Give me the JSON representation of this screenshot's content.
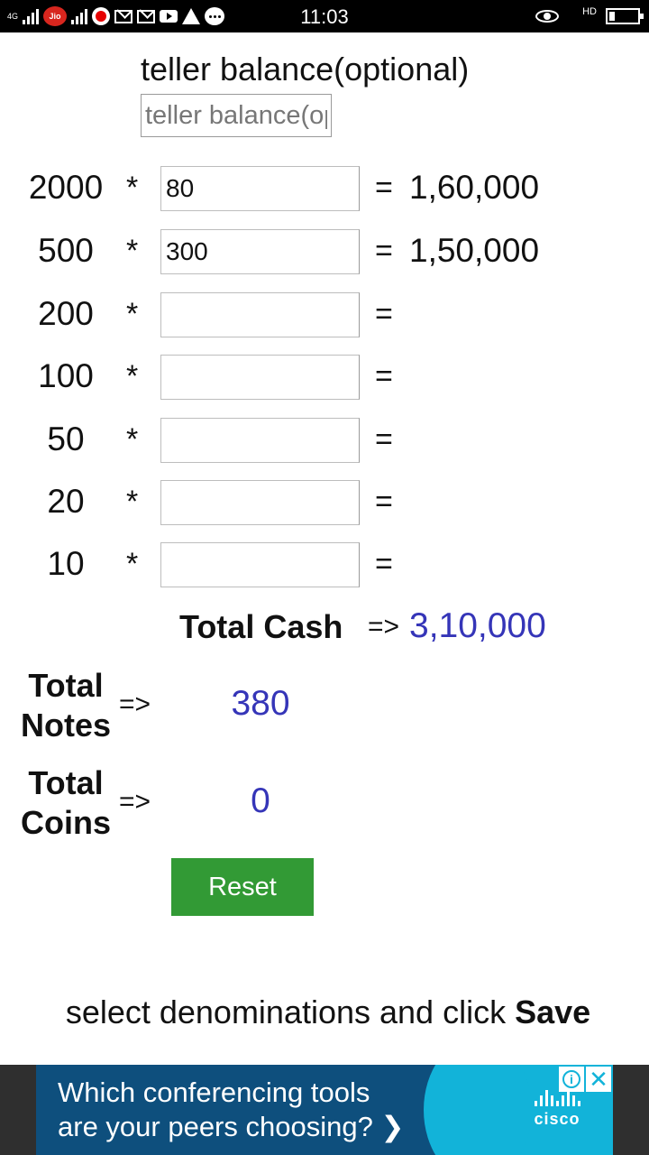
{
  "status_bar": {
    "network": "4G",
    "carrier_badge": "Jio",
    "time": "11:03",
    "hd": "HD",
    "icons": [
      "signal-icon",
      "jio-icon",
      "vodafone-icon",
      "mail-icon",
      "gmail-icon",
      "youtube-icon",
      "warning-icon",
      "chat-icon",
      "eye-icon",
      "call-hd-icon",
      "battery-icon"
    ]
  },
  "teller": {
    "label": "teller balance(optional)",
    "placeholder": "teller balance(optional)",
    "value": ""
  },
  "denominations": [
    {
      "denom": "2000",
      "op": "*",
      "qty": "80",
      "eq": "=",
      "amount": "1,60,000"
    },
    {
      "denom": "500",
      "op": "*",
      "qty": "300",
      "eq": "=",
      "amount": "1,50,000"
    },
    {
      "denom": "200",
      "op": "*",
      "qty": "",
      "eq": "=",
      "amount": ""
    },
    {
      "denom": "100",
      "op": "*",
      "qty": "",
      "eq": "=",
      "amount": ""
    },
    {
      "denom": "50",
      "op": "*",
      "qty": "",
      "eq": "=",
      "amount": ""
    },
    {
      "denom": "20",
      "op": "*",
      "qty": "",
      "eq": "=",
      "amount": ""
    },
    {
      "denom": "10",
      "op": "*",
      "qty": "",
      "eq": "=",
      "amount": ""
    }
  ],
  "totals": {
    "cash_label": "Total Cash",
    "cash_arrow": "=>",
    "cash_value": "3,10,000",
    "notes_label_1": "Total",
    "notes_label_2": "Notes",
    "notes_arrow": "=>",
    "notes_value": "380",
    "coins_label_1": "Total",
    "coins_label_2": "Coins",
    "coins_arrow": "=>",
    "coins_value": "0"
  },
  "actions": {
    "reset_label": "Reset",
    "hint_prefix": "select denominations and click ",
    "hint_bold": "Save"
  },
  "ad": {
    "line1": "Which conferencing tools",
    "line2": "are your peers choosing?",
    "chevron": "❯",
    "brand": "cisco",
    "info": "i",
    "close": "✕"
  },
  "colors": {
    "value_blue": "#3535b8",
    "reset_green": "#329a35",
    "ad_navy": "#0e4f7d",
    "ad_cyan": "#12b3d9"
  }
}
